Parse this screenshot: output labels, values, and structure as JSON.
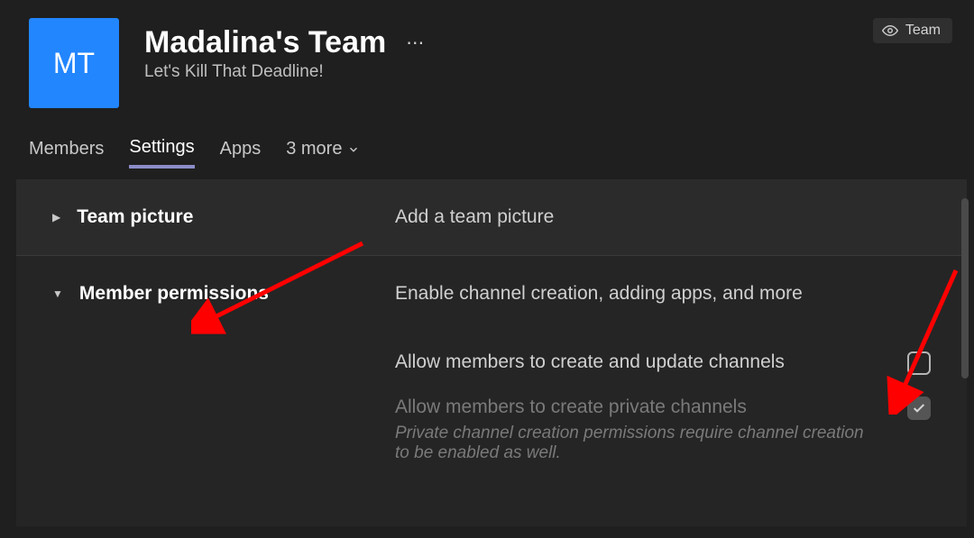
{
  "header": {
    "avatar_initials": "MT",
    "title": "Madalina's Team",
    "more_glyph": "⋯",
    "subtitle": "Let's Kill That Deadline!",
    "team_pill_label": "Team"
  },
  "tabs": {
    "members": "Members",
    "settings": "Settings",
    "apps": "Apps",
    "more": "3 more"
  },
  "settings": {
    "team_picture": {
      "title": "Team picture",
      "desc": "Add a team picture"
    },
    "member_permissions": {
      "title": "Member permissions",
      "desc": "Enable channel creation, adding apps, and more",
      "perm1": {
        "label": "Allow members to create and update channels",
        "checked": false
      },
      "perm2": {
        "label": "Allow members to create private channels",
        "checked": true,
        "hint": "Private channel creation permissions require channel creation to be enabled as well."
      }
    }
  }
}
